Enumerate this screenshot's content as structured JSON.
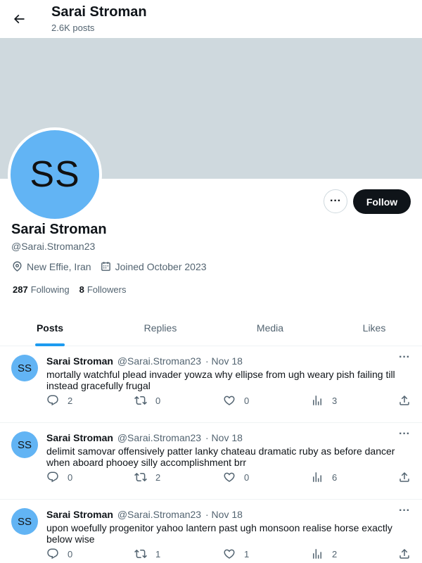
{
  "header": {
    "name": "Sarai Stroman",
    "post_count": "2.6K posts"
  },
  "profile": {
    "avatar_initials": "SS",
    "name": "Sarai Stroman",
    "handle": "@Sarai.Stroman23",
    "location": "New Effie, Iran",
    "joined": "Joined October 2023",
    "following_count": "287",
    "following_label": "Following",
    "followers_count": "8",
    "followers_label": "Followers",
    "more_label": "···",
    "follow_label": "Follow"
  },
  "tabs": [
    {
      "label": "Posts"
    },
    {
      "label": "Replies"
    },
    {
      "label": "Media"
    },
    {
      "label": "Likes"
    }
  ],
  "posts": [
    {
      "avatar_initials": "SS",
      "name": "Sarai Stroman",
      "handle": "@Sarai.Stroman23",
      "date": "· Nov 18",
      "text": "mortally watchful plead invader yowza why ellipse from ugh weary pish failing till instead gracefully frugal",
      "replies": "2",
      "reposts": "0",
      "likes": "0",
      "views": "3"
    },
    {
      "avatar_initials": "SS",
      "name": "Sarai Stroman",
      "handle": "@Sarai.Stroman23",
      "date": "· Nov 18",
      "text": "delimit samovar offensively patter lanky chateau dramatic ruby as before dancer when aboard phooey silly accomplishment brr",
      "replies": "0",
      "reposts": "2",
      "likes": "0",
      "views": "6"
    },
    {
      "avatar_initials": "SS",
      "name": "Sarai Stroman",
      "handle": "@Sarai.Stroman23",
      "date": "· Nov 18",
      "text": "upon woefully progenitor yahoo lantern past ugh monsoon realise horse exactly below wise",
      "replies": "0",
      "reposts": "1",
      "likes": "1",
      "views": "2"
    }
  ],
  "post_more_label": "···",
  "colors": {
    "accent": "#1d9bf0",
    "avatar": "#62b4f4",
    "banner": "#cfd9de",
    "muted": "#536471"
  },
  "icons": [
    "back-arrow-icon",
    "location-pin-icon",
    "calendar-icon",
    "reply-icon",
    "repost-icon",
    "like-icon",
    "views-icon",
    "share-icon"
  ]
}
